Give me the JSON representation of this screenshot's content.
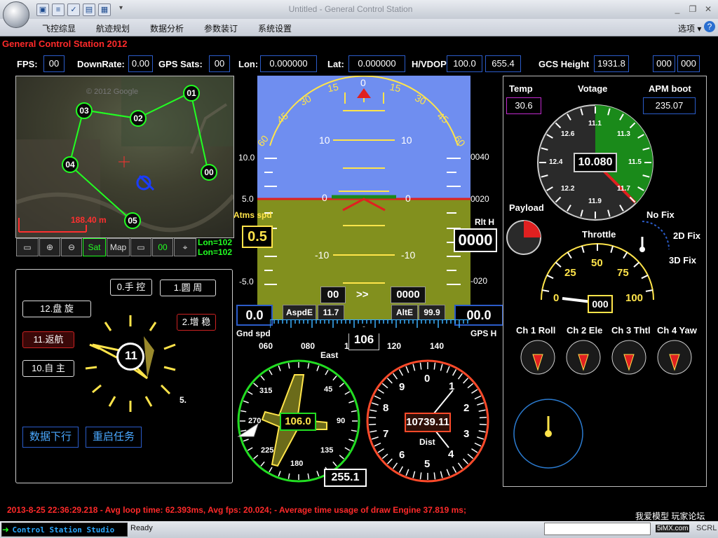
{
  "window": {
    "title": "Untitled - General Control Station"
  },
  "menu": [
    {
      "label": "飞控综显"
    },
    {
      "label": "航迹规划"
    },
    {
      "label": "数据分析"
    },
    {
      "label": "参数装订"
    },
    {
      "label": "系统设置"
    }
  ],
  "options_label": "选项",
  "app_title": "General Control Station 2012",
  "header": {
    "fps": {
      "label": "FPS:",
      "value": "00"
    },
    "downrate": {
      "label": "DownRate:",
      "value": "0.00"
    },
    "gps_sats": {
      "label": "GPS Sats:",
      "value": "00"
    },
    "lon": {
      "label": "Lon:",
      "value": "0.000000"
    },
    "lat": {
      "label": "Lat:",
      "value": "0.000000"
    },
    "hvdop": {
      "label": "H/VDOP",
      "h": "100.0",
      "v": "655.4"
    },
    "gcs_height": {
      "label": "GCS Height",
      "value": "1931.8"
    },
    "extra1": "000",
    "extra2": "000"
  },
  "map": {
    "copyright": "© 2012 Google",
    "scale": "188.40 m",
    "waypoints": [
      {
        "id": "01"
      },
      {
        "id": "02"
      },
      {
        "id": "03"
      },
      {
        "id": "04"
      },
      {
        "id": "05"
      },
      {
        "id": "00"
      }
    ],
    "toolbar": {
      "sat": "Sat",
      "map": "Map",
      "counter": "00"
    },
    "lon_text_1": "Lon=102",
    "lon_text_2": "Lon=102"
  },
  "modes": {
    "m0": "0.手 控",
    "m1": "1.圆 周",
    "m2": "2.增 稳",
    "m12": "12.盘 旋",
    "m11": "11.返航",
    "m10": "10.自 主",
    "m5": "5.",
    "current": "11",
    "btn_download": "数据下行",
    "btn_restart": "重启任务"
  },
  "hud": {
    "pitch_labels": [
      "10",
      "0",
      "-10"
    ],
    "pitch_labels_neg": "-10",
    "roll_ticks": [
      "60",
      "45",
      "30",
      "15",
      "0",
      "15",
      "30",
      "45",
      "60"
    ],
    "alt_scale": [
      "10.0",
      "5.0",
      "-5.0"
    ],
    "right_scale": [
      "0040",
      "0020",
      "-020"
    ],
    "airspeed_label": "Atms spd",
    "airspeed": "0.5",
    "relalt_label": "Rlt H",
    "relalt": "0000",
    "box_left": "00",
    "arrows": ">>",
    "box_right": "0000",
    "gnd_spd": "0.0",
    "gnd_spd_label": "Gnd spd",
    "aspd_err_label": "AspdE",
    "aspd_err": "11.7",
    "alt_err_label": "AltE",
    "alt_err": "99.9",
    "gps_h": "00.0",
    "gps_h_label": "GPS H",
    "heading_ticks": [
      "060",
      "080",
      "1",
      "120",
      "140"
    ],
    "heading": "106",
    "heading_dir": "East"
  },
  "compass": {
    "value": "106.0",
    "bottom": "255.1",
    "labels": [
      "315",
      "45",
      "270",
      "90",
      "225",
      "135",
      "180"
    ]
  },
  "dist": {
    "value": "10739.11",
    "label": "Dist",
    "numbers": [
      "0",
      "1",
      "2",
      "3",
      "4",
      "5",
      "6",
      "7",
      "8",
      "9"
    ]
  },
  "right": {
    "temp_label": "Temp",
    "temp": "30.6",
    "voltage_label": "Votage",
    "apm_label": "APM boot",
    "apm": "235.07",
    "voltage": "10.080",
    "volt_ticks": [
      "11.1",
      "11.3",
      "11.5",
      "11.7",
      "11.9",
      "12.2",
      "12.4",
      "12.6"
    ],
    "payload_label": "Payload",
    "nofix": "No Fix",
    "fix2d": "2D Fix",
    "fix3d": "3D Fix",
    "throttle_label": "Throttle",
    "throttle": "000",
    "throttle_ticks": [
      "0",
      "25",
      "50",
      "75",
      "100"
    ],
    "channels": [
      "Ch 1 Roll",
      "Ch 2 Ele",
      "Ch 3 Thtl",
      "Ch 4 Yaw"
    ]
  },
  "status": {
    "line": "2013-8-25  22:36:29.218    - Avg loop time: 62.393ms, Avg fps: 20.024;   - Average time usage of draw Engine 37.819 ms;",
    "studio": "Control Station Studio",
    "ready": "Ready",
    "scrl": "SCRL",
    "site": "5iMX.com",
    "watermark": "我爱模型 玩家论坛"
  }
}
